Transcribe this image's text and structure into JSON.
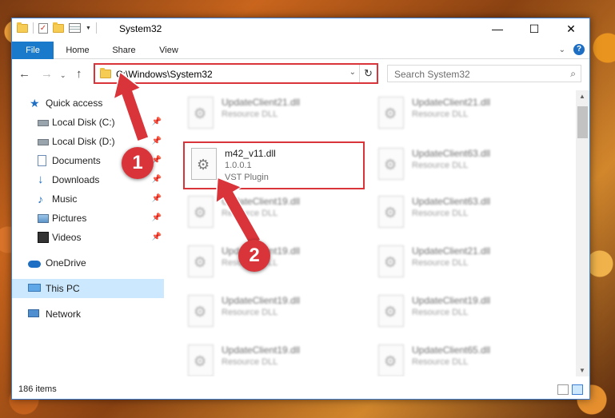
{
  "window": {
    "title": "System32",
    "controls": {
      "minimize": "—",
      "maximize": "☐",
      "close": "✕"
    }
  },
  "ribbon": {
    "tabs": [
      "File",
      "Home",
      "Share",
      "View"
    ],
    "expand_icon": "chevron-down-icon",
    "help_label": "?"
  },
  "address": {
    "path": "C:\\Windows\\System32",
    "search_placeholder": "Search System32"
  },
  "nav": [
    {
      "label": "Quick access",
      "icon": "star-icon",
      "pinned": false,
      "indent": false
    },
    {
      "label": "Local Disk (C:)",
      "icon": "drive-icon",
      "pinned": true,
      "indent": true
    },
    {
      "label": "Local Disk (D:)",
      "icon": "drive-icon",
      "pinned": true,
      "indent": true
    },
    {
      "label": "Documents",
      "icon": "documents-icon",
      "pinned": true,
      "indent": true
    },
    {
      "label": "Downloads",
      "icon": "download-icon",
      "pinned": true,
      "indent": true
    },
    {
      "label": "Music",
      "icon": "music-icon",
      "pinned": true,
      "indent": true
    },
    {
      "label": "Pictures",
      "icon": "pictures-icon",
      "pinned": true,
      "indent": true
    },
    {
      "label": "Videos",
      "icon": "video-icon",
      "pinned": true,
      "indent": true
    },
    {
      "label": "OneDrive",
      "icon": "cloud-icon",
      "pinned": false,
      "indent": false
    },
    {
      "label": "This PC",
      "icon": "computer-icon",
      "pinned": false,
      "indent": false
    },
    {
      "label": "Network",
      "icon": "network-icon",
      "pinned": false,
      "indent": false
    }
  ],
  "files": [
    {
      "name": "UpdateClient21.dll",
      "ver": "",
      "desc": "Resource DLL"
    },
    {
      "name": "UpdateClient21.dll",
      "ver": "",
      "desc": "Resource DLL"
    },
    {
      "name": "m42_v11.dll",
      "ver": "1.0.0.1",
      "desc": "VST Plugin"
    },
    {
      "name": "UpdateClient63.dll",
      "ver": "",
      "desc": "Resource DLL"
    },
    {
      "name": "UpdateClient19.dll",
      "ver": "",
      "desc": "Resource DLL"
    },
    {
      "name": "UpdateClient63.dll",
      "ver": "",
      "desc": "Resource DLL"
    },
    {
      "name": "UpdateClient19.dll",
      "ver": "",
      "desc": "Resource DLL"
    },
    {
      "name": "UpdateClient21.dll",
      "ver": "",
      "desc": "Resource DLL"
    },
    {
      "name": "UpdateClient19.dll",
      "ver": "",
      "desc": "Resource DLL"
    },
    {
      "name": "UpdateClient19.dll",
      "ver": "",
      "desc": "Resource DLL"
    },
    {
      "name": "UpdateClient19.dll",
      "ver": "",
      "desc": "Resource DLL"
    },
    {
      "name": "UpdateClient65.dll",
      "ver": "",
      "desc": "Resource DLL"
    }
  ],
  "status": {
    "count": "186 items"
  },
  "annotations": {
    "step1": "1",
    "step2": "2",
    "color": "#d9343a"
  },
  "accent": "#1979ca"
}
